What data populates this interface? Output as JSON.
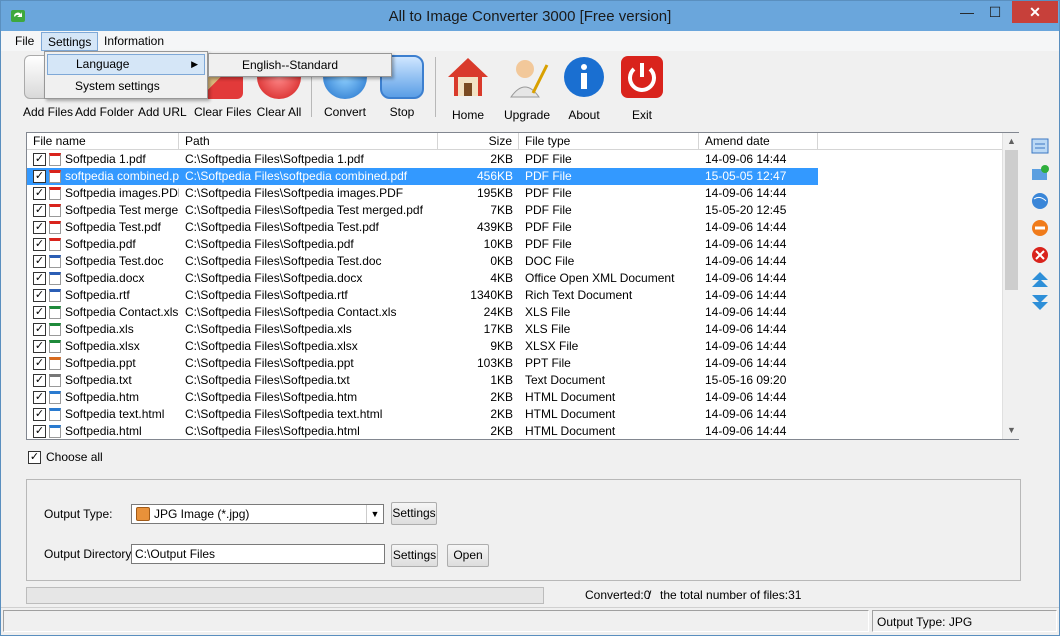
{
  "window": {
    "title": "All to Image Converter 3000 [Free version]",
    "min_glyph": "—",
    "max_glyph": "☐",
    "close_glyph": "✕"
  },
  "menubar": [
    "File",
    "Settings",
    "Information"
  ],
  "settings_menu": {
    "items": [
      "Language",
      "System settings"
    ],
    "language_submenu": "English--Standard"
  },
  "toolbar": {
    "buttons": [
      {
        "label": "Add Files",
        "icon": "add-files-icon"
      },
      {
        "label": "Add Folder",
        "icon": "add-folder-icon"
      },
      {
        "label": "Add URL",
        "icon": "add-url-icon"
      },
      {
        "label": "Clear Files",
        "icon": "clear-files-icon"
      },
      {
        "label": "Clear All",
        "icon": "clear-all-icon"
      },
      {
        "label": "Convert",
        "icon": "convert-icon"
      },
      {
        "label": "Stop",
        "icon": "stop-icon"
      },
      {
        "label": "Home",
        "icon": "home-icon"
      },
      {
        "label": "Upgrade",
        "icon": "upgrade-icon"
      },
      {
        "label": "About",
        "icon": "about-icon"
      },
      {
        "label": "Exit",
        "icon": "exit-icon"
      }
    ]
  },
  "grid": {
    "columns": [
      "File name",
      "Path",
      "Size",
      "File type",
      "Amend date"
    ],
    "rows": [
      {
        "name": "Softpedia 1.pdf",
        "path": "C:\\Softpedia Files\\Softpedia 1.pdf",
        "size": "2KB",
        "type": "PDF File",
        "date": "14-09-06 14:44",
        "kind": "pdf"
      },
      {
        "name": "softpedia combined.pdf",
        "path": "C:\\Softpedia Files\\softpedia combined.pdf",
        "size": "456KB",
        "type": "PDF File",
        "date": "15-05-05 12:47",
        "kind": "pdf",
        "selected": true
      },
      {
        "name": "Softpedia images.PDF",
        "path": "C:\\Softpedia Files\\Softpedia images.PDF",
        "size": "195KB",
        "type": "PDF File",
        "date": "14-09-06 14:44",
        "kind": "pdf"
      },
      {
        "name": "Softpedia Test merge...",
        "path": "C:\\Softpedia Files\\Softpedia Test merged.pdf",
        "size": "7KB",
        "type": "PDF File",
        "date": "15-05-20 12:45",
        "kind": "pdf"
      },
      {
        "name": "Softpedia Test.pdf",
        "path": "C:\\Softpedia Files\\Softpedia Test.pdf",
        "size": "439KB",
        "type": "PDF File",
        "date": "14-09-06 14:44",
        "kind": "pdf"
      },
      {
        "name": "Softpedia.pdf",
        "path": "C:\\Softpedia Files\\Softpedia.pdf",
        "size": "10KB",
        "type": "PDF File",
        "date": "14-09-06 14:44",
        "kind": "pdf"
      },
      {
        "name": "Softpedia Test.doc",
        "path": "C:\\Softpedia Files\\Softpedia Test.doc",
        "size": "0KB",
        "type": "DOC File",
        "date": "14-09-06 14:44",
        "kind": "doc"
      },
      {
        "name": "Softpedia.docx",
        "path": "C:\\Softpedia Files\\Softpedia.docx",
        "size": "4KB",
        "type": "Office Open XML Document",
        "date": "14-09-06 14:44",
        "kind": "doc"
      },
      {
        "name": "Softpedia.rtf",
        "path": "C:\\Softpedia Files\\Softpedia.rtf",
        "size": "1340KB",
        "type": "Rich Text Document",
        "date": "14-09-06 14:44",
        "kind": "doc"
      },
      {
        "name": "Softpedia Contact.xls",
        "path": "C:\\Softpedia Files\\Softpedia Contact.xls",
        "size": "24KB",
        "type": "XLS File",
        "date": "14-09-06 14:44",
        "kind": "xls"
      },
      {
        "name": "Softpedia.xls",
        "path": "C:\\Softpedia Files\\Softpedia.xls",
        "size": "17KB",
        "type": "XLS File",
        "date": "14-09-06 14:44",
        "kind": "xls"
      },
      {
        "name": "Softpedia.xlsx",
        "path": "C:\\Softpedia Files\\Softpedia.xlsx",
        "size": "9KB",
        "type": "XLSX File",
        "date": "14-09-06 14:44",
        "kind": "xls"
      },
      {
        "name": "Softpedia.ppt",
        "path": "C:\\Softpedia Files\\Softpedia.ppt",
        "size": "103KB",
        "type": "PPT File",
        "date": "14-09-06 14:44",
        "kind": "ppt"
      },
      {
        "name": "Softpedia.txt",
        "path": "C:\\Softpedia Files\\Softpedia.txt",
        "size": "1KB",
        "type": "Text Document",
        "date": "15-05-16 09:20",
        "kind": "txt"
      },
      {
        "name": "Softpedia.htm",
        "path": "C:\\Softpedia Files\\Softpedia.htm",
        "size": "2KB",
        "type": "HTML Document",
        "date": "14-09-06 14:44",
        "kind": "htm"
      },
      {
        "name": "Softpedia text.html",
        "path": "C:\\Softpedia Files\\Softpedia text.html",
        "size": "2KB",
        "type": "HTML Document",
        "date": "14-09-06 14:44",
        "kind": "htm"
      },
      {
        "name": "Softpedia.html",
        "path": "C:\\Softpedia Files\\Softpedia.html",
        "size": "2KB",
        "type": "HTML Document",
        "date": "14-09-06 14:44",
        "kind": "htm"
      }
    ]
  },
  "choose_all": {
    "label": "Choose all",
    "checked": true
  },
  "output": {
    "type_label": "Output Type:",
    "type_value": "JPG Image (*.jpg)",
    "type_settings": "Settings",
    "dir_label": "Output Directory:",
    "dir_value": "C:\\Output Files",
    "dir_settings": "Settings",
    "open": "Open"
  },
  "progress": {
    "fraction": 0
  },
  "status": {
    "converted": "Converted:0",
    "separator": "/",
    "total": "the total number of files:31",
    "output_type": "Output Type: JPG"
  },
  "colors": {
    "selection": "#3399ff",
    "titlebar": "#6aa6dc",
    "close": "#c7403a"
  }
}
